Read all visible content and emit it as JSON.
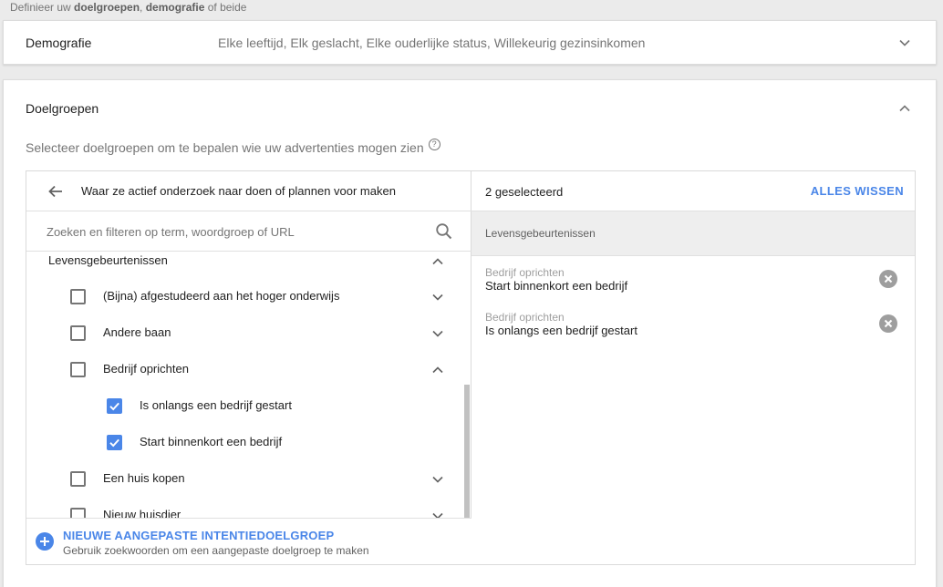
{
  "top_hint": {
    "prefix": "Definieer uw ",
    "bold1": "doelgroepen",
    "sep": ", ",
    "bold2": "demografie",
    "suffix": " of beide"
  },
  "demografie": {
    "title": "Demografie",
    "summary": "Elke leeftijd, Elk geslacht, Elke ouderlijke status, Willekeurig gezinsinkomen"
  },
  "doelgroepen": {
    "title": "Doelgroepen",
    "subtitle": "Selecteer doelgroepen om te bepalen wie uw advertenties mogen zien",
    "help_glyph": "?"
  },
  "browser": {
    "breadcrumb": "Waar ze actief onderzoek naar doen of plannen voor maken",
    "search_placeholder": "Zoeken en filteren op term, woordgroep of URL",
    "section": "Levensgebeurtenissen",
    "items": [
      {
        "label": "(Bijna) afgestudeerd aan het hoger onderwijs",
        "checked": false,
        "expanded": false
      },
      {
        "label": "Andere baan",
        "checked": false,
        "expanded": false
      },
      {
        "label": "Bedrijf oprichten",
        "checked": false,
        "expanded": true
      },
      {
        "label": "Is onlangs een bedrijf gestart",
        "checked": true,
        "child": true
      },
      {
        "label": "Start binnenkort een bedrijf",
        "checked": true,
        "child": true
      },
      {
        "label": "Een huis kopen",
        "checked": false,
        "expanded": false
      },
      {
        "label": "Nieuw huisdier",
        "checked": false,
        "expanded": false
      }
    ],
    "footer_action": "NIEUWE AANGEPASTE INTENTIEDOELGROEP",
    "footer_hint": "Gebruik zoekwoorden om een aangepaste doelgroep te maken"
  },
  "selection": {
    "count_label": "2 geselecteerd",
    "clear_label": "ALLES WISSEN",
    "group_title": "Levensgebeurtenissen",
    "items": [
      {
        "category": "Bedrijf oprichten",
        "name": "Start binnenkort een bedrijf"
      },
      {
        "category": "Bedrijf oprichten",
        "name": "Is onlangs een bedrijf gestart"
      }
    ]
  },
  "colors": {
    "accent": "#4a86e8",
    "background": "#ebebeb",
    "muted_text": "#757575"
  },
  "icons": [
    "chevron-down-icon",
    "chevron-up-icon",
    "help-icon",
    "arrow-left-icon",
    "search-icon",
    "checkbox-icon",
    "plus-circle-icon",
    "remove-circle-icon"
  ]
}
